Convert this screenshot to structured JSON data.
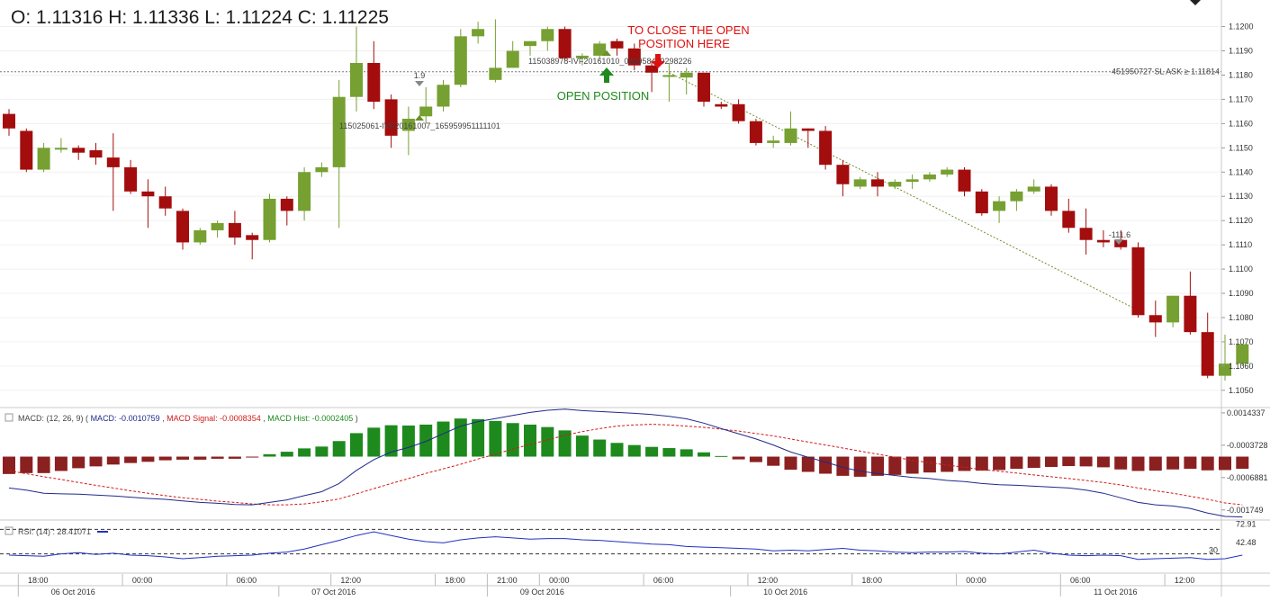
{
  "ohlc_label": "O: 1.11316 H: 1.11336 L: 1.11224 C: 1.11225",
  "colors": {
    "bull": "#76a032",
    "bear": "#a30d0d",
    "macd": "#1f2a8a",
    "signal": "#d11a1a",
    "hist_pos": "#1e8a1e",
    "hist_neg": "#8b2020",
    "rsi": "#2230c0",
    "annot": "#e01010",
    "open_pos": "#1e8a1e"
  },
  "chart_data": [
    {
      "type": "candlestick",
      "ylim": [
        1.1044,
        1.1208
      ],
      "y_ticks": [
        "1.1200",
        "1.1190",
        "1.1180",
        "1.1170",
        "1.1160",
        "1.1150",
        "1.1140",
        "1.1130",
        "1.1120",
        "1.1110",
        "1.1100",
        "1.1090",
        "1.1080",
        "1.1070",
        "1.1060",
        "1.1050"
      ],
      "y_tick_values": [
        1.12,
        1.119,
        1.118,
        1.117,
        1.116,
        1.115,
        1.114,
        1.113,
        1.112,
        1.111,
        1.11,
        1.109,
        1.108,
        1.107,
        1.106,
        1.105
      ],
      "candles": [
        {
          "o": 1.1164,
          "h": 1.1166,
          "l": 1.1155,
          "c": 1.1158
        },
        {
          "o": 1.1157,
          "h": 1.1158,
          "l": 1.114,
          "c": 1.1141
        },
        {
          "o": 1.1141,
          "h": 1.1152,
          "l": 1.114,
          "c": 1.115
        },
        {
          "o": 1.115,
          "h": 1.1154,
          "l": 1.1148,
          "c": 1.115
        },
        {
          "o": 1.115,
          "h": 1.1151,
          "l": 1.1145,
          "c": 1.1148
        },
        {
          "o": 1.1149,
          "h": 1.1152,
          "l": 1.1143,
          "c": 1.1146
        },
        {
          "o": 1.1146,
          "h": 1.1156,
          "l": 1.1124,
          "c": 1.1142
        },
        {
          "o": 1.1142,
          "h": 1.1145,
          "l": 1.1131,
          "c": 1.1132
        },
        {
          "o": 1.1132,
          "h": 1.1137,
          "l": 1.1117,
          "c": 1.113
        },
        {
          "o": 1.113,
          "h": 1.1134,
          "l": 1.1122,
          "c": 1.1125
        },
        {
          "o": 1.1124,
          "h": 1.1125,
          "l": 1.1108,
          "c": 1.1111
        },
        {
          "o": 1.1111,
          "h": 1.1117,
          "l": 1.111,
          "c": 1.1116
        },
        {
          "o": 1.1116,
          "h": 1.112,
          "l": 1.1113,
          "c": 1.1119
        },
        {
          "o": 1.1119,
          "h": 1.1124,
          "l": 1.111,
          "c": 1.1113
        },
        {
          "o": 1.1114,
          "h": 1.1115,
          "l": 1.1104,
          "c": 1.1112
        },
        {
          "o": 1.1112,
          "h": 1.1131,
          "l": 1.1111,
          "c": 1.1129
        },
        {
          "o": 1.1129,
          "h": 1.113,
          "l": 1.1118,
          "c": 1.1124
        },
        {
          "o": 1.1124,
          "h": 1.1142,
          "l": 1.112,
          "c": 1.114
        },
        {
          "o": 1.114,
          "h": 1.1144,
          "l": 1.1138,
          "c": 1.1142
        },
        {
          "o": 1.1142,
          "h": 1.1178,
          "l": 1.1117,
          "c": 1.1171
        },
        {
          "o": 1.1171,
          "h": 1.12,
          "l": 1.1165,
          "c": 1.1185
        },
        {
          "o": 1.1185,
          "h": 1.1194,
          "l": 1.1166,
          "c": 1.1169
        },
        {
          "o": 1.117,
          "h": 1.1172,
          "l": 1.115,
          "c": 1.1155
        },
        {
          "o": 1.1157,
          "h": 1.1167,
          "l": 1.1147,
          "c": 1.1162
        },
        {
          "o": 1.1163,
          "h": 1.1175,
          "l": 1.116,
          "c": 1.1167
        },
        {
          "o": 1.1167,
          "h": 1.1178,
          "l": 1.1165,
          "c": 1.1176
        },
        {
          "o": 1.1176,
          "h": 1.1199,
          "l": 1.1175,
          "c": 1.1196
        },
        {
          "o": 1.1196,
          "h": 1.1202,
          "l": 1.1193,
          "c": 1.1199
        },
        {
          "o": 1.1178,
          "h": 1.1203,
          "l": 1.1177,
          "c": 1.1183
        },
        {
          "o": 1.1183,
          "h": 1.1194,
          "l": 1.1183,
          "c": 1.119
        },
        {
          "o": 1.1192,
          "h": 1.1194,
          "l": 1.1188,
          "c": 1.1194
        },
        {
          "o": 1.1194,
          "h": 1.12,
          "l": 1.119,
          "c": 1.1199
        },
        {
          "o": 1.1199,
          "h": 1.12,
          "l": 1.1186,
          "c": 1.1187
        },
        {
          "o": 1.1187,
          "h": 1.1189,
          "l": 1.1184,
          "c": 1.1188
        },
        {
          "o": 1.1188,
          "h": 1.1194,
          "l": 1.1186,
          "c": 1.1193
        },
        {
          "o": 1.1194,
          "h": 1.1195,
          "l": 1.1188,
          "c": 1.1191
        },
        {
          "o": 1.1191,
          "h": 1.1193,
          "l": 1.1182,
          "c": 1.1184
        },
        {
          "o": 1.1184,
          "h": 1.1186,
          "l": 1.1173,
          "c": 1.1181
        },
        {
          "o": 1.118,
          "h": 1.1185,
          "l": 1.1169,
          "c": 1.118
        },
        {
          "o": 1.1179,
          "h": 1.1183,
          "l": 1.1172,
          "c": 1.1181
        },
        {
          "o": 1.1181,
          "h": 1.1181,
          "l": 1.1167,
          "c": 1.1169
        },
        {
          "o": 1.1168,
          "h": 1.1169,
          "l": 1.1166,
          "c": 1.1167
        },
        {
          "o": 1.1168,
          "h": 1.117,
          "l": 1.116,
          "c": 1.1161
        },
        {
          "o": 1.1161,
          "h": 1.1162,
          "l": 1.1151,
          "c": 1.1152
        },
        {
          "o": 1.1152,
          "h": 1.1155,
          "l": 1.115,
          "c": 1.1153
        },
        {
          "o": 1.1152,
          "h": 1.1165,
          "l": 1.1151,
          "c": 1.1158
        },
        {
          "o": 1.1158,
          "h": 1.1158,
          "l": 1.115,
          "c": 1.1157
        },
        {
          "o": 1.1157,
          "h": 1.1159,
          "l": 1.1141,
          "c": 1.1143
        },
        {
          "o": 1.1143,
          "h": 1.1145,
          "l": 1.113,
          "c": 1.1135
        },
        {
          "o": 1.1134,
          "h": 1.1138,
          "l": 1.1133,
          "c": 1.1137
        },
        {
          "o": 1.1137,
          "h": 1.114,
          "l": 1.113,
          "c": 1.1134
        },
        {
          "o": 1.1134,
          "h": 1.1137,
          "l": 1.1133,
          "c": 1.1136
        },
        {
          "o": 1.1136,
          "h": 1.1139,
          "l": 1.1133,
          "c": 1.1137
        },
        {
          "o": 1.1137,
          "h": 1.114,
          "l": 1.1136,
          "c": 1.1139
        },
        {
          "o": 1.1139,
          "h": 1.1142,
          "l": 1.1138,
          "c": 1.1141
        },
        {
          "o": 1.1141,
          "h": 1.1142,
          "l": 1.113,
          "c": 1.1132
        },
        {
          "o": 1.1132,
          "h": 1.1133,
          "l": 1.1122,
          "c": 1.1123
        },
        {
          "o": 1.1124,
          "h": 1.113,
          "l": 1.1119,
          "c": 1.1128
        },
        {
          "o": 1.1128,
          "h": 1.1133,
          "l": 1.1124,
          "c": 1.1132
        },
        {
          "o": 1.1132,
          "h": 1.1137,
          "l": 1.1131,
          "c": 1.1134
        },
        {
          "o": 1.1134,
          "h": 1.1135,
          "l": 1.1122,
          "c": 1.1124
        },
        {
          "o": 1.1124,
          "h": 1.1129,
          "l": 1.1115,
          "c": 1.1117
        },
        {
          "o": 1.1117,
          "h": 1.1125,
          "l": 1.1106,
          "c": 1.1112
        },
        {
          "o": 1.1112,
          "h": 1.1116,
          "l": 1.1109,
          "c": 1.1111
        },
        {
          "o": 1.1112,
          "h": 1.1116,
          "l": 1.1108,
          "c": 1.1109
        },
        {
          "o": 1.1109,
          "h": 1.1111,
          "l": 1.108,
          "c": 1.1081
        },
        {
          "o": 1.1081,
          "h": 1.1087,
          "l": 1.1072,
          "c": 1.1078
        },
        {
          "o": 1.1078,
          "h": 1.1089,
          "l": 1.1076,
          "c": 1.1089
        },
        {
          "o": 1.1089,
          "h": 1.1099,
          "l": 1.1073,
          "c": 1.1074
        },
        {
          "o": 1.1074,
          "h": 1.1082,
          "l": 1.1055,
          "c": 1.1056
        },
        {
          "o": 1.1056,
          "h": 1.1073,
          "l": 1.1054,
          "c": 1.1061
        },
        {
          "o": 1.1061,
          "h": 1.1069,
          "l": 1.106,
          "c": 1.1069
        }
      ]
    },
    {
      "type": "line",
      "title": "MACD: (12, 26, 9)",
      "legend": [
        {
          "text": "MACD: -0.0010759",
          "color": "#1f2a8a"
        },
        {
          "text": "MACD Signal: -0.0008354",
          "color": "#d11a1a"
        },
        {
          "text": "MACD Hist: -0.0002405",
          "color": "#1e8a1e"
        }
      ],
      "ylim": [
        -0.00205,
        0.00155
      ],
      "y_ticks": [
        "0.0014337",
        "-0.0003728",
        "-0.0006881",
        "-0.001749"
      ],
      "y_tick_values": [
        0.0014337,
        0.0003728,
        -0.0006881,
        -0.001749
      ],
      "macd": [
        -0.00103,
        -0.0011,
        -0.0012,
        -0.00122,
        -0.00123,
        -0.00126,
        -0.00129,
        -0.00133,
        -0.00137,
        -0.0014,
        -0.00145,
        -0.0015,
        -0.00153,
        -0.00157,
        -0.00158,
        -0.0015,
        -0.00142,
        -0.00128,
        -0.00115,
        -0.00088,
        -0.00045,
        -0.0001,
        0.00015,
        0.0003,
        0.0005,
        0.00075,
        0.001,
        0.00115,
        0.00125,
        0.00135,
        0.00145,
        0.00152,
        0.00156,
        0.00151,
        0.00148,
        0.00145,
        0.00142,
        0.00138,
        0.00132,
        0.00124,
        0.0011,
        0.00092,
        0.00075,
        0.00058,
        0.00038,
        0.00015,
        -2e-05,
        -0.00018,
        -0.00035,
        -0.00048,
        -0.00055,
        -0.00062,
        -0.00068,
        -0.00072,
        -0.00078,
        -0.00082,
        -0.00088,
        -0.00092,
        -0.00094,
        -0.00097,
        -0.001,
        -0.00103,
        -0.0011,
        -0.0012,
        -0.00135,
        -0.0015,
        -0.00158,
        -0.00162,
        -0.0017,
        -0.00185,
        -0.00196,
        -0.00198
      ],
      "signal": [
        -0.00046,
        -0.00056,
        -0.00066,
        -0.00075,
        -0.00085,
        -0.00094,
        -0.00103,
        -0.00112,
        -0.0012,
        -0.00128,
        -0.00135,
        -0.0014,
        -0.00146,
        -0.0015,
        -0.00155,
        -0.00158,
        -0.00158,
        -0.00155,
        -0.00148,
        -0.00139,
        -0.00122,
        -0.00105,
        -0.00088,
        -0.00072,
        -0.00055,
        -0.0004,
        -0.00025,
        -8e-05,
        8e-05,
        0.00025,
        0.0004,
        0.00055,
        0.0007,
        0.00082,
        0.00092,
        0.001,
        0.00104,
        0.00106,
        0.00104,
        0.001,
        0.00096,
        0.0009,
        0.00084,
        0.00076,
        0.00068,
        0.00058,
        0.00048,
        0.00038,
        0.00028,
        0.00018,
        8e-05,
        -2e-05,
        -0.00012,
        -0.0002,
        -0.00028,
        -0.00035,
        -0.00042,
        -0.00048,
        -0.00054,
        -0.0006,
        -0.00066,
        -0.00072,
        -0.00078,
        -0.00085,
        -0.00093,
        -0.00103,
        -0.00112,
        -0.0012,
        -0.0013,
        -0.0014,
        -0.00152,
        -0.00158
      ],
      "hist": [
        -0.00057,
        -0.00054,
        -0.00054,
        -0.00047,
        -0.00038,
        -0.00032,
        -0.00026,
        -0.00021,
        -0.00017,
        -0.00012,
        -0.0001,
        -0.0001,
        -7e-05,
        -7e-05,
        -3e-05,
        8e-05,
        0.00016,
        0.00027,
        0.00033,
        0.00051,
        0.00077,
        0.00095,
        0.00103,
        0.00102,
        0.00105,
        0.00115,
        0.00125,
        0.00123,
        0.00117,
        0.0011,
        0.00105,
        0.00097,
        0.00086,
        0.00069,
        0.00056,
        0.00045,
        0.00038,
        0.00032,
        0.00028,
        0.00024,
        0.00014,
        2e-05,
        -9e-05,
        -0.00018,
        -0.0003,
        -0.00043,
        -0.0005,
        -0.00056,
        -0.00063,
        -0.00066,
        -0.00063,
        -0.0006,
        -0.00056,
        -0.00052,
        -0.0005,
        -0.00047,
        -0.00046,
        -0.00044,
        -0.0004,
        -0.00037,
        -0.00034,
        -0.00031,
        -0.00032,
        -0.00035,
        -0.00042,
        -0.00047,
        -0.00046,
        -0.00042,
        -0.0004,
        -0.00045,
        -0.00044,
        -0.0004
      ]
    },
    {
      "type": "line",
      "title": "RSI: (14) : 28.41071",
      "ylim": [
        0,
        100
      ],
      "y_ticks": [
        "72.91",
        "42.48",
        "30"
      ],
      "y_tick_values": [
        72.91,
        42.48,
        30
      ],
      "levels": [
        70,
        30
      ],
      "values": [
        28,
        27,
        26,
        30,
        32,
        29,
        31,
        28,
        27,
        25,
        22,
        24,
        26,
        27,
        28,
        31,
        33,
        38,
        45,
        52,
        60,
        66,
        60,
        54,
        50,
        48,
        53,
        56,
        58,
        56,
        54,
        55,
        55,
        53,
        52,
        50,
        48,
        46,
        45,
        42,
        41,
        40,
        39,
        38,
        35,
        36,
        35,
        37,
        39,
        36,
        35,
        33,
        32,
        33,
        33,
        34,
        31,
        30,
        33,
        36,
        31,
        28,
        27,
        28,
        27,
        21,
        22,
        23,
        24,
        21,
        22,
        28
      ]
    }
  ],
  "axis": {
    "time_ticks": [
      {
        "label": "18:00",
        "i": 1
      },
      {
        "label": "00:00",
        "i": 7
      },
      {
        "label": "06:00",
        "i": 13
      },
      {
        "label": "12:00",
        "i": 19
      },
      {
        "label": "18:00",
        "i": 25
      },
      {
        "label": "21:00",
        "i": 28
      },
      {
        "label": "00:00",
        "i": 31
      },
      {
        "label": "06:00",
        "i": 37
      },
      {
        "label": "12:00",
        "i": 43
      },
      {
        "label": "18:00",
        "i": 49
      },
      {
        "label": "00:00",
        "i": 55
      },
      {
        "label": "06:00",
        "i": 61
      },
      {
        "label": "12:00",
        "i": 67
      }
    ],
    "date_ticks": [
      {
        "label": "06 Oct 2016",
        "i": 1
      },
      {
        "label": "07 Oct 2016",
        "i": 16
      },
      {
        "label": "09 Oct 2016",
        "i": 28
      },
      {
        "label": "10 Oct 2016",
        "i": 42
      },
      {
        "label": "11 Oct 2016",
        "i": 61
      }
    ]
  },
  "annotations": {
    "sl_line_value": 1.11814,
    "sl_label": "451950727 SL ASK ≥ 1.11814",
    "close_text_line1": "TO CLOSE THE OPEN",
    "close_text_line2": "POSITION HERE",
    "open_position_text": "OPEN POSITION",
    "order_label_1": "115025061-IVF20161007_165959951111101",
    "order_label_2": "115038978-IVF20161010_085958439298226",
    "marker_label_1": "1.9",
    "marker_label_2": "-111.6",
    "trend_start": {
      "i": 38,
      "price": 1.1181
    },
    "trend_end": {
      "i": 65,
      "price": 1.1083
    }
  }
}
